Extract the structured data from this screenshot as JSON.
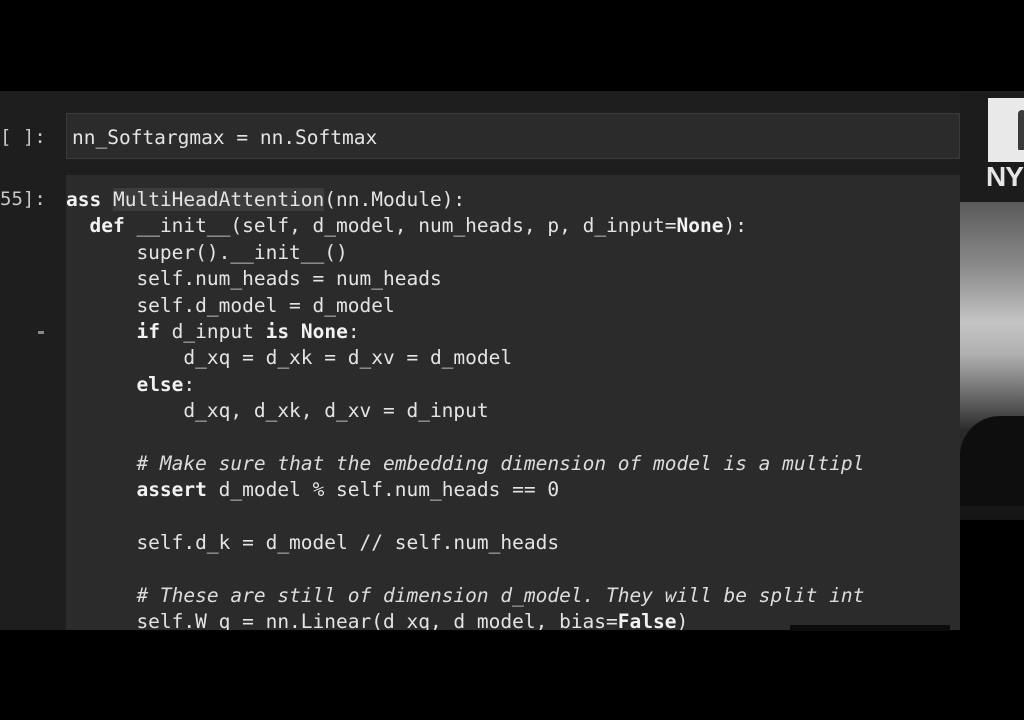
{
  "cells": [
    {
      "prompt": "[ ]:",
      "code": "nn_Softargmax = nn.Softmax"
    },
    {
      "prompt": "55]:",
      "lines": [
        {
          "segments": [
            {
              "t": "ass ",
              "k": "kw"
            },
            {
              "t": "MultiHeadAttention",
              "k": "hl"
            },
            {
              "t": "(nn.Module):"
            }
          ]
        },
        {
          "segments": [
            {
              "t": "  "
            },
            {
              "t": "def",
              "k": "kw"
            },
            {
              "t": " __init__(self, d_model, num_heads, p, d_input="
            },
            {
              "t": "None",
              "k": "kw"
            },
            {
              "t": "):"
            }
          ]
        },
        {
          "segments": [
            {
              "t": "      super().__init__()"
            }
          ]
        },
        {
          "segments": [
            {
              "t": "      self.num_heads = num_heads"
            }
          ]
        },
        {
          "segments": [
            {
              "t": "      self.d_model = d_model"
            }
          ]
        },
        {
          "segments": [
            {
              "t": "      "
            },
            {
              "t": "if",
              "k": "kw"
            },
            {
              "t": " d_input "
            },
            {
              "t": "is",
              "k": "kw"
            },
            {
              "t": " "
            },
            {
              "t": "None",
              "k": "kw"
            },
            {
              "t": ":"
            }
          ]
        },
        {
          "segments": [
            {
              "t": "          d_xq = d_xk = d_xv = d_model"
            }
          ]
        },
        {
          "segments": [
            {
              "t": "      "
            },
            {
              "t": "else",
              "k": "kw"
            },
            {
              "t": ":"
            }
          ]
        },
        {
          "segments": [
            {
              "t": "          d_xq, d_xk, d_xv = d_input"
            }
          ]
        },
        {
          "segments": [
            {
              "t": ""
            }
          ]
        },
        {
          "segments": [
            {
              "t": "      "
            },
            {
              "t": "# Make sure that the embedding dimension of model is a multipl",
              "k": "cm"
            }
          ]
        },
        {
          "segments": [
            {
              "t": "      "
            },
            {
              "t": "assert",
              "k": "kw"
            },
            {
              "t": " d_model % self.num_heads == 0"
            }
          ]
        },
        {
          "segments": [
            {
              "t": ""
            }
          ]
        },
        {
          "segments": [
            {
              "t": "      self.d_k = d_model // self.num_heads"
            }
          ]
        },
        {
          "segments": [
            {
              "t": ""
            }
          ]
        },
        {
          "segments": [
            {
              "t": "      "
            },
            {
              "t": "# These are still of dimension d_model. They will be split int",
              "k": "cm"
            }
          ]
        },
        {
          "segments": [
            {
              "t": "      self.W_q = nn.Linear(d_xq, d_model, bias="
            },
            {
              "t": "False",
              "k": "kw"
            },
            {
              "t": ")"
            }
          ]
        }
      ]
    }
  ],
  "overlay": {
    "logo_text": "NY"
  }
}
